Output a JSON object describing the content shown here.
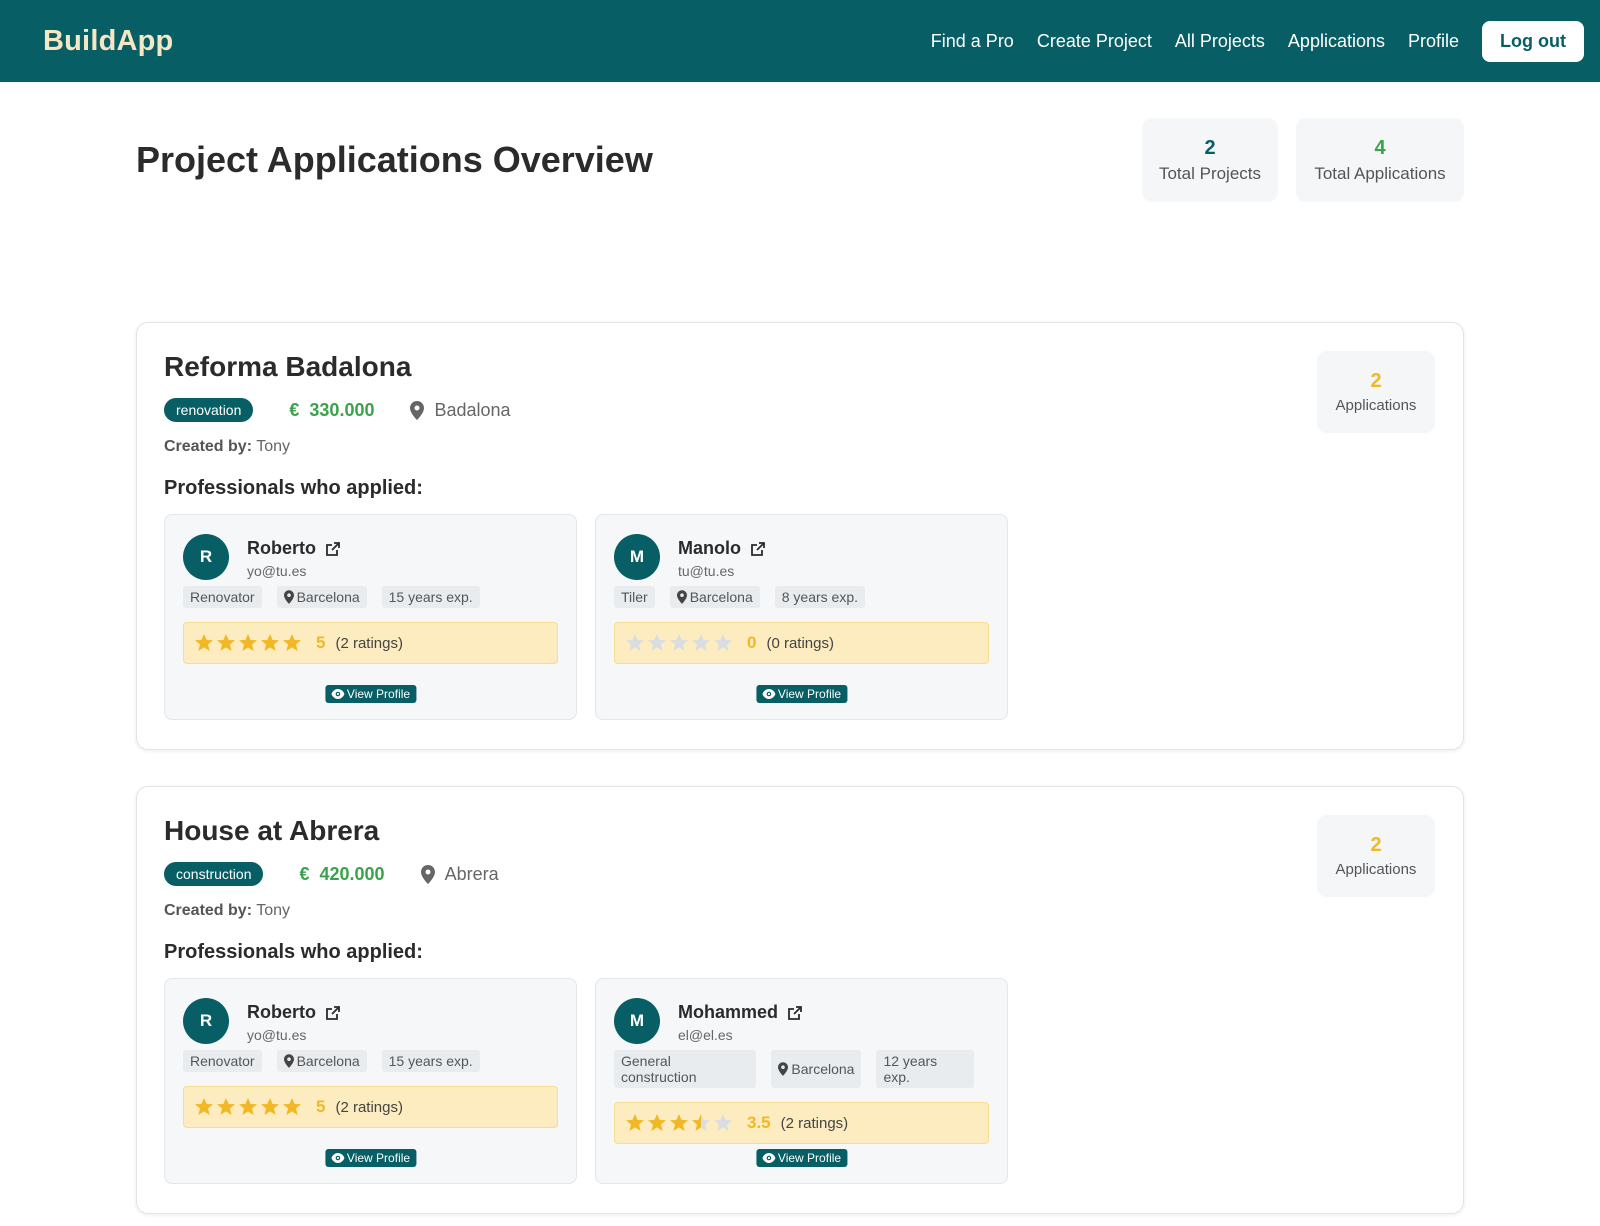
{
  "brand": "BuildApp",
  "nav": {
    "find_pro": "Find a Pro",
    "create_project": "Create Project",
    "all_projects": "All Projects",
    "applications": "Applications",
    "profile": "Profile",
    "logout": "Log out"
  },
  "colors": {
    "primary": "#075e64",
    "success": "#3aa34a",
    "warning": "#f2b824",
    "brand_text": "#f5e6c4"
  },
  "title": "Project Applications Overview",
  "stats": {
    "total_projects": {
      "value": "2",
      "label": "Total Projects"
    },
    "total_applications": {
      "value": "4",
      "label": "Total Applications"
    }
  },
  "labels": {
    "created_by": "Created by:",
    "professionals_applied": "Professionals who applied:",
    "applications": "Applications",
    "view_profile": "View Profile"
  },
  "projects": [
    {
      "title": "Reforma Badalona",
      "category": "renovation",
      "currency": "€",
      "budget": "330.000",
      "location": "Badalona",
      "created_by": "Tony",
      "applications_count": "2",
      "professionals": [
        {
          "initial": "R",
          "name": "Roberto",
          "email": "yo@tu.es",
          "profession": "Renovator",
          "city": "Barcelona",
          "experience": "15 years exp.",
          "rating": "5",
          "rating_value": 5,
          "ratings_count": "(2 ratings)"
        },
        {
          "initial": "M",
          "name": "Manolo",
          "email": "tu@tu.es",
          "profession": "Tiler",
          "city": "Barcelona",
          "experience": "8 years exp.",
          "rating": "0",
          "rating_value": 0,
          "ratings_count": "(0 ratings)"
        }
      ]
    },
    {
      "title": "House at Abrera",
      "category": "construction",
      "currency": "€",
      "budget": "420.000",
      "location": "Abrera",
      "created_by": "Tony",
      "applications_count": "2",
      "professionals": [
        {
          "initial": "R",
          "name": "Roberto",
          "email": "yo@tu.es",
          "profession": "Renovator",
          "city": "Barcelona",
          "experience": "15 years exp.",
          "rating": "5",
          "rating_value": 5,
          "ratings_count": "(2 ratings)"
        },
        {
          "initial": "M",
          "name": "Mohammed",
          "email": "el@el.es",
          "profession": "General construction",
          "city": "Barcelona",
          "experience": "12 years exp.",
          "rating": "3.5",
          "rating_value": 3.5,
          "ratings_count": "(2 ratings)"
        }
      ]
    }
  ]
}
